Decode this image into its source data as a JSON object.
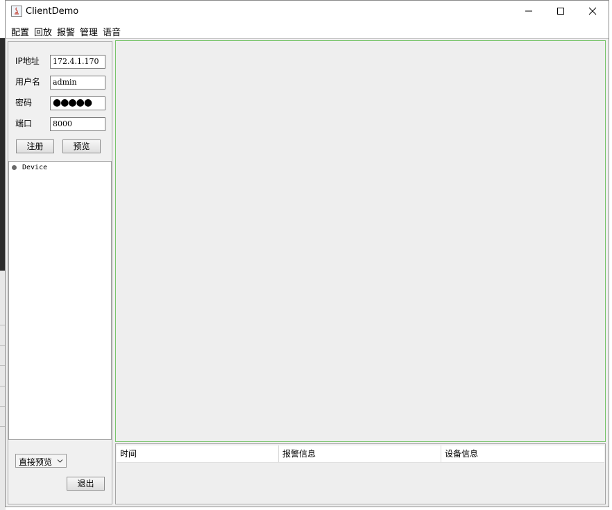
{
  "window": {
    "title": "ClientDemo"
  },
  "menu": [
    "配置",
    "回放",
    "报警",
    "管理",
    "语音"
  ],
  "login": {
    "ip_label": "IP地址",
    "ip_value": "172.4.1.170",
    "user_label": "用户名",
    "user_value": "admin",
    "password_label": "密码",
    "password_mask": "●●●●●",
    "port_label": "端口",
    "port_value": "8000",
    "register_button": "注册",
    "preview_button": "预览"
  },
  "tree": {
    "root_label": "Device"
  },
  "preview_mode": {
    "selected": "直接预览"
  },
  "exit_button": "退出",
  "alarm_table": {
    "columns": [
      "时间",
      "报警信息",
      "设备信息"
    ]
  }
}
